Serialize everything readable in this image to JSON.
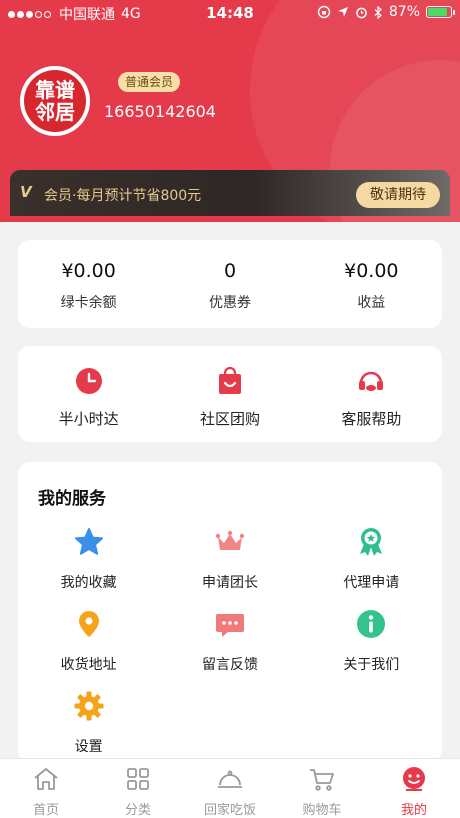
{
  "status_bar": {
    "carrier": "中国联通",
    "network": "4G",
    "time": "14:48",
    "battery": "87%",
    "battery_level": 0.87
  },
  "profile": {
    "logo_text_line1": "靠谱",
    "logo_text_line2": "邻居",
    "member_tier": "普通会员",
    "phone": "16650142604"
  },
  "vip_banner": {
    "badge": "V",
    "text": "会员·每月预计节省800元",
    "button": "敬请期待"
  },
  "balance": [
    {
      "value": "¥0.00",
      "label": "绿卡余额"
    },
    {
      "value": "0",
      "label": "优惠券"
    },
    {
      "value": "¥0.00",
      "label": "收益"
    }
  ],
  "quick_actions": [
    {
      "label": "半小时达",
      "icon": "clock-icon"
    },
    {
      "label": "社区团购",
      "icon": "shopping-bag-icon"
    },
    {
      "label": "客服帮助",
      "icon": "headset-icon"
    }
  ],
  "services": {
    "title": "我的服务",
    "items": [
      {
        "label": "我的收藏",
        "icon": "star-icon"
      },
      {
        "label": "申请团长",
        "icon": "crown-icon"
      },
      {
        "label": "代理申请",
        "icon": "award-ribbon-icon"
      },
      {
        "label": "收货地址",
        "icon": "location-pin-icon"
      },
      {
        "label": "留言反馈",
        "icon": "message-icon"
      },
      {
        "label": "关于我们",
        "icon": "info-icon"
      },
      {
        "label": "设置",
        "icon": "gear-icon"
      }
    ]
  },
  "tabbar": {
    "items": [
      {
        "label": "首页",
        "icon": "home-icon"
      },
      {
        "label": "分类",
        "icon": "grid-icon"
      },
      {
        "label": "回家吃饭",
        "icon": "dish-cover-icon"
      },
      {
        "label": "购物车",
        "icon": "cart-icon"
      },
      {
        "label": "我的",
        "icon": "user-face-icon"
      }
    ],
    "active_index": 4
  },
  "colors": {
    "brand_red": "#e53a4a",
    "gold": "#e7c98c",
    "tab_inactive": "#9a9a9a"
  }
}
